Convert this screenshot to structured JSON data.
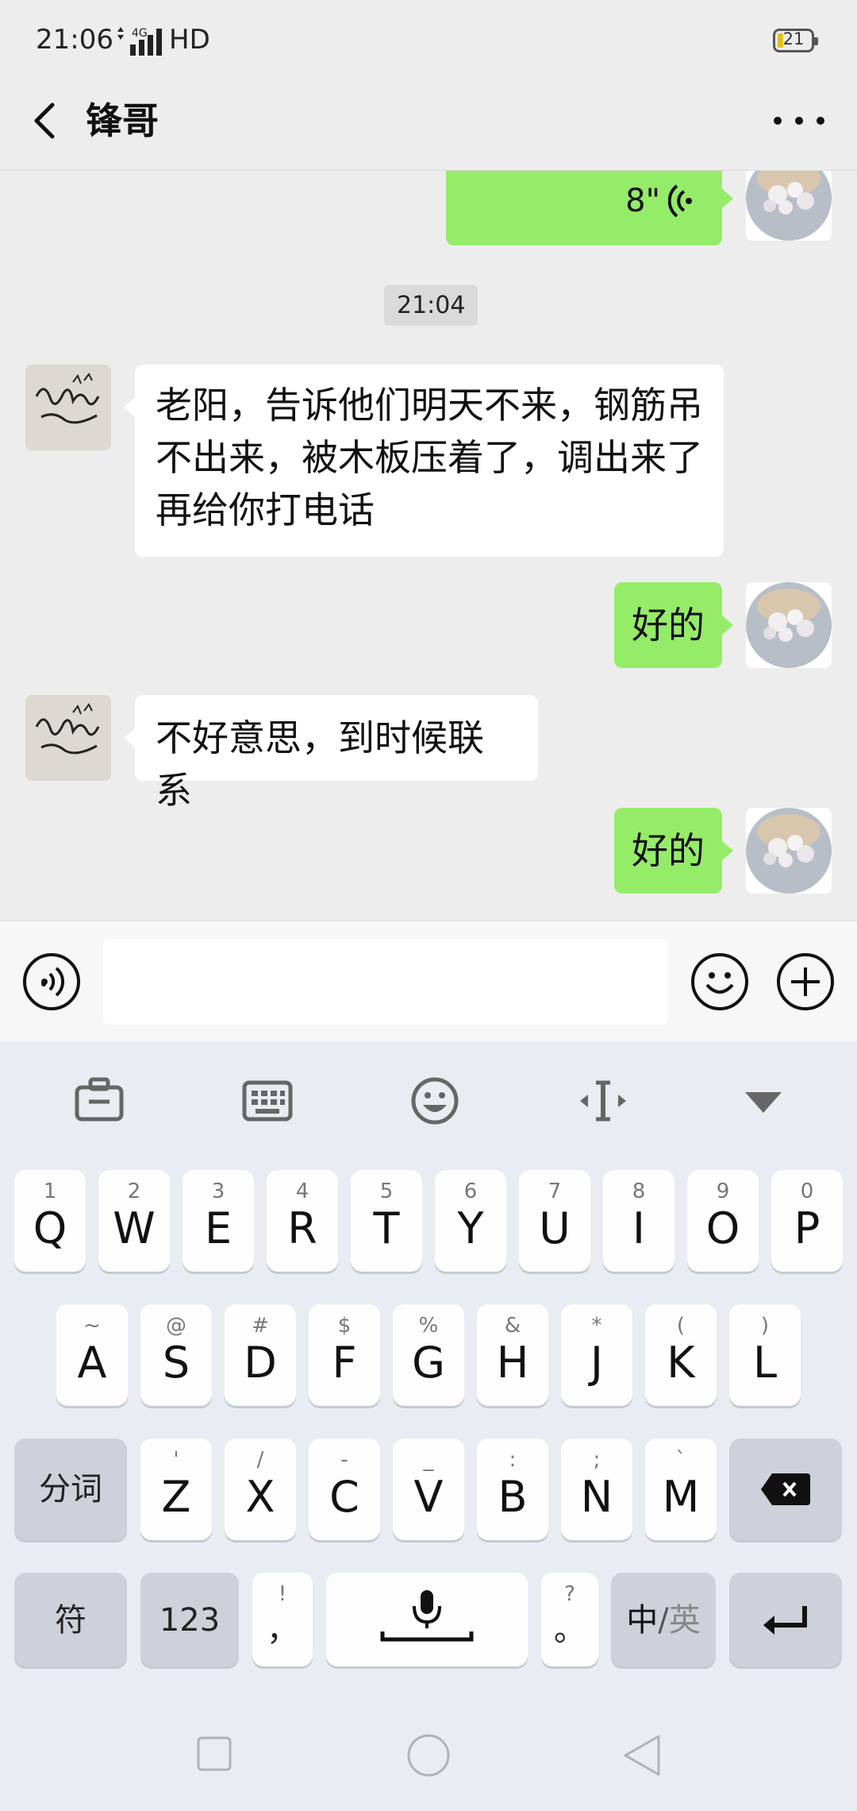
{
  "status_bar": {
    "time": "21:06",
    "network": "4G",
    "hd": "HD",
    "battery": "21"
  },
  "header": {
    "title": "锋哥"
  },
  "chat": {
    "messages": [
      {
        "side": "out",
        "type": "voice",
        "duration": "8\""
      },
      {
        "side": "center",
        "type": "time",
        "text": "21:04"
      },
      {
        "side": "in",
        "type": "text",
        "lines": [
          "老阳，告诉他们明天不来，钢筋吊",
          "不出来，被木板压着了，调出来了",
          "再给你打电话"
        ]
      },
      {
        "side": "out",
        "type": "text",
        "text": "好的"
      },
      {
        "side": "in",
        "type": "text",
        "text": "不好意思，到时候联系"
      },
      {
        "side": "out",
        "type": "text",
        "text": "好的"
      }
    ]
  },
  "input_bar": {
    "value": "",
    "icons": [
      "voice-icon",
      "emoji-icon",
      "plus-icon"
    ]
  },
  "keyboard": {
    "toolbar": [
      "toolbox-icon",
      "keyboard-icon",
      "emoji-icon",
      "cursor-icon",
      "collapse-icon"
    ],
    "row1": [
      {
        "k": "Q",
        "s": "1"
      },
      {
        "k": "W",
        "s": "2"
      },
      {
        "k": "E",
        "s": "3"
      },
      {
        "k": "R",
        "s": "4"
      },
      {
        "k": "T",
        "s": "5"
      },
      {
        "k": "Y",
        "s": "6"
      },
      {
        "k": "U",
        "s": "7"
      },
      {
        "k": "I",
        "s": "8"
      },
      {
        "k": "O",
        "s": "9"
      },
      {
        "k": "P",
        "s": "0"
      }
    ],
    "row2": [
      {
        "k": "A",
        "s": "~"
      },
      {
        "k": "S",
        "s": "@"
      },
      {
        "k": "D",
        "s": "#"
      },
      {
        "k": "F",
        "s": "$"
      },
      {
        "k": "G",
        "s": "%"
      },
      {
        "k": "H",
        "s": "&"
      },
      {
        "k": "J",
        "s": "*"
      },
      {
        "k": "K",
        "s": "("
      },
      {
        "k": "L",
        "s": ")"
      }
    ],
    "row3": [
      {
        "k": "Z",
        "s": "'"
      },
      {
        "k": "X",
        "s": "/"
      },
      {
        "k": "C",
        "s": "-"
      },
      {
        "k": "V",
        "s": "_"
      },
      {
        "k": "B",
        "s": ":"
      },
      {
        "k": "N",
        "s": ";"
      },
      {
        "k": "M",
        "s": "`"
      }
    ],
    "segment_label": "分词",
    "symbol_label": "符",
    "num_label": "123",
    "comma": {
      "main": "，",
      "sub": "!"
    },
    "period": {
      "main": "。",
      "sub": "?"
    },
    "lang": {
      "active": "中",
      "sep": "/",
      "inactive": "英"
    }
  },
  "colors": {
    "outgoing_bubble": "#95ec69",
    "incoming_bubble": "#ffffff",
    "chat_bg": "#ededed",
    "keyboard_bg": "#e9ecf2"
  }
}
